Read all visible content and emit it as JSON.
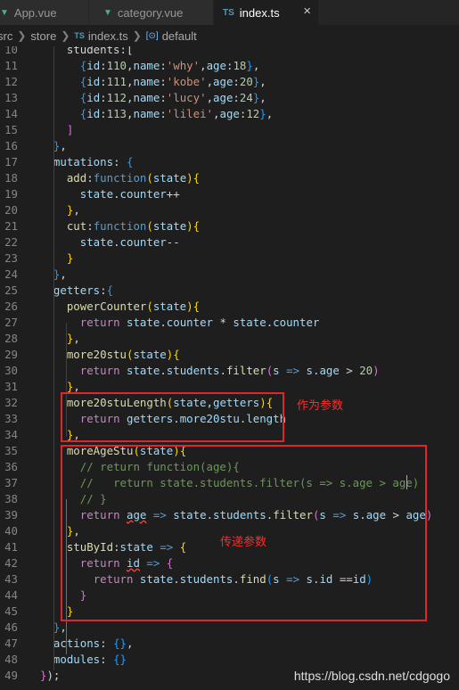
{
  "tabs": [
    {
      "label": "App.vue",
      "icon": "vue-icon"
    },
    {
      "label": "category.vue",
      "icon": "vue-icon"
    },
    {
      "label": "index.ts",
      "icon": "ts-icon",
      "active": true
    }
  ],
  "breadcrumb": {
    "folder1": "src",
    "folder2": "store",
    "file": "index.ts",
    "symbol": "default",
    "ts_badge": "TS"
  },
  "editor": {
    "lines": [
      {
        "n": "10",
        "t": [
          [
            "v",
            "    students:["
          ]
        ]
      },
      {
        "n": "11",
        "t": [
          [
            "v",
            "      "
          ],
          [
            "b3",
            "{"
          ],
          [
            "p",
            "id"
          ],
          [
            "v",
            ":"
          ],
          [
            "n",
            "110"
          ],
          [
            "v",
            ","
          ],
          [
            "p",
            "name"
          ],
          [
            "v",
            ":"
          ],
          [
            "s",
            "'why'"
          ],
          [
            "v",
            ","
          ],
          [
            "p",
            "age"
          ],
          [
            "v",
            ":"
          ],
          [
            "n",
            "18"
          ],
          [
            "b3",
            "}"
          ],
          [
            "v",
            ","
          ]
        ]
      },
      {
        "n": "12",
        "t": [
          [
            "v",
            "      "
          ],
          [
            "b3",
            "{"
          ],
          [
            "p",
            "id"
          ],
          [
            "v",
            ":"
          ],
          [
            "n",
            "111"
          ],
          [
            "v",
            ","
          ],
          [
            "p",
            "name"
          ],
          [
            "v",
            ":"
          ],
          [
            "s",
            "'kobe'"
          ],
          [
            "v",
            ","
          ],
          [
            "p",
            "age"
          ],
          [
            "v",
            ":"
          ],
          [
            "n",
            "20"
          ],
          [
            "b3",
            "}"
          ],
          [
            "v",
            ","
          ]
        ]
      },
      {
        "n": "13",
        "t": [
          [
            "v",
            "      "
          ],
          [
            "b3",
            "{"
          ],
          [
            "p",
            "id"
          ],
          [
            "v",
            ":"
          ],
          [
            "n",
            "112"
          ],
          [
            "v",
            ","
          ],
          [
            "p",
            "name"
          ],
          [
            "v",
            ":"
          ],
          [
            "s",
            "'lucy'"
          ],
          [
            "v",
            ","
          ],
          [
            "p",
            "age"
          ],
          [
            "v",
            ":"
          ],
          [
            "n",
            "24"
          ],
          [
            "b3",
            "}"
          ],
          [
            "v",
            ","
          ]
        ]
      },
      {
        "n": "14",
        "t": [
          [
            "v",
            "      "
          ],
          [
            "b3",
            "{"
          ],
          [
            "p",
            "id"
          ],
          [
            "v",
            ":"
          ],
          [
            "n",
            "113"
          ],
          [
            "v",
            ","
          ],
          [
            "p",
            "name"
          ],
          [
            "v",
            ":"
          ],
          [
            "s",
            "'lilei'"
          ],
          [
            "v",
            ","
          ],
          [
            "p",
            "age"
          ],
          [
            "v",
            ":"
          ],
          [
            "n",
            "12"
          ],
          [
            "b3",
            "}"
          ],
          [
            "v",
            ","
          ]
        ]
      },
      {
        "n": "15",
        "t": [
          [
            "v",
            "    "
          ],
          [
            "b2",
            "]"
          ]
        ]
      },
      {
        "n": "16",
        "t": [
          [
            "v",
            "  "
          ],
          [
            "b3",
            "}"
          ],
          [
            "v",
            ","
          ]
        ]
      },
      {
        "n": "17",
        "t": [
          [
            "v",
            "  "
          ],
          [
            "p",
            "mutations"
          ],
          [
            "v",
            ": "
          ],
          [
            "b3",
            "{"
          ]
        ]
      },
      {
        "n": "18",
        "t": [
          [
            "v",
            "    "
          ],
          [
            "f",
            "add"
          ],
          [
            "v",
            ":"
          ],
          [
            "k",
            "function"
          ],
          [
            "b1",
            "("
          ],
          [
            "p",
            "state"
          ],
          [
            "b1",
            ")"
          ],
          [
            "b1",
            "{"
          ]
        ]
      },
      {
        "n": "19",
        "t": [
          [
            "v",
            "      "
          ],
          [
            "p",
            "state"
          ],
          [
            "v",
            "."
          ],
          [
            "p",
            "counter"
          ],
          [
            "v",
            "++"
          ]
        ]
      },
      {
        "n": "20",
        "t": [
          [
            "v",
            "    "
          ],
          [
            "b1",
            "}"
          ],
          [
            "v",
            ","
          ]
        ]
      },
      {
        "n": "21",
        "t": [
          [
            "v",
            "    "
          ],
          [
            "f",
            "cut"
          ],
          [
            "v",
            ":"
          ],
          [
            "k",
            "function"
          ],
          [
            "b1",
            "("
          ],
          [
            "p",
            "state"
          ],
          [
            "b1",
            ")"
          ],
          [
            "b1",
            "{"
          ]
        ]
      },
      {
        "n": "22",
        "t": [
          [
            "v",
            "      "
          ],
          [
            "p",
            "state"
          ],
          [
            "v",
            "."
          ],
          [
            "p",
            "counter"
          ],
          [
            "v",
            "--"
          ]
        ]
      },
      {
        "n": "23",
        "t": [
          [
            "v",
            "    "
          ],
          [
            "b1",
            "}"
          ]
        ]
      },
      {
        "n": "24",
        "t": [
          [
            "v",
            "  "
          ],
          [
            "b3",
            "}"
          ],
          [
            "v",
            ","
          ]
        ]
      },
      {
        "n": "25",
        "t": [
          [
            "v",
            "  "
          ],
          [
            "p",
            "getters"
          ],
          [
            "v",
            ":"
          ],
          [
            "b3",
            "{"
          ]
        ]
      },
      {
        "n": "26",
        "t": [
          [
            "v",
            "    "
          ],
          [
            "f",
            "powerCounter"
          ],
          [
            "b1",
            "("
          ],
          [
            "p",
            "state"
          ],
          [
            "b1",
            ")"
          ],
          [
            "b1",
            "{"
          ]
        ]
      },
      {
        "n": "27",
        "t": [
          [
            "v",
            "      "
          ],
          [
            "ctl",
            "return"
          ],
          [
            "v",
            " "
          ],
          [
            "p",
            "state"
          ],
          [
            "v",
            "."
          ],
          [
            "p",
            "counter"
          ],
          [
            "v",
            " * "
          ],
          [
            "p",
            "state"
          ],
          [
            "v",
            "."
          ],
          [
            "p",
            "counter"
          ]
        ]
      },
      {
        "n": "28",
        "t": [
          [
            "v",
            "    "
          ],
          [
            "b1",
            "}"
          ],
          [
            "v",
            ","
          ]
        ]
      },
      {
        "n": "29",
        "t": [
          [
            "v",
            "    "
          ],
          [
            "f",
            "more20stu"
          ],
          [
            "b1",
            "("
          ],
          [
            "p",
            "state"
          ],
          [
            "b1",
            ")"
          ],
          [
            "b1",
            "{"
          ]
        ]
      },
      {
        "n": "30",
        "t": [
          [
            "v",
            "      "
          ],
          [
            "ctl",
            "return"
          ],
          [
            "v",
            " "
          ],
          [
            "p",
            "state"
          ],
          [
            "v",
            "."
          ],
          [
            "p",
            "students"
          ],
          [
            "v",
            "."
          ],
          [
            "f",
            "filter"
          ],
          [
            "b2",
            "("
          ],
          [
            "p",
            "s"
          ],
          [
            "v",
            " "
          ],
          [
            "k",
            "=>"
          ],
          [
            "v",
            " "
          ],
          [
            "p",
            "s"
          ],
          [
            "v",
            "."
          ],
          [
            "p",
            "age"
          ],
          [
            "v",
            " > "
          ],
          [
            "n",
            "20"
          ],
          [
            "b2",
            ")"
          ]
        ]
      },
      {
        "n": "31",
        "t": [
          [
            "v",
            "    "
          ],
          [
            "b1",
            "}"
          ],
          [
            "v",
            ","
          ]
        ]
      },
      {
        "n": "32",
        "t": [
          [
            "v",
            "    "
          ],
          [
            "f",
            "more20stuLength"
          ],
          [
            "b1",
            "("
          ],
          [
            "p",
            "state"
          ],
          [
            "v",
            ","
          ],
          [
            "p",
            "getters"
          ],
          [
            "b1",
            ")"
          ],
          [
            "b1",
            "{"
          ]
        ]
      },
      {
        "n": "33",
        "t": [
          [
            "v",
            "      "
          ],
          [
            "ctl",
            "return"
          ],
          [
            "v",
            " "
          ],
          [
            "p",
            "getters"
          ],
          [
            "v",
            "."
          ],
          [
            "p",
            "more20stu"
          ],
          [
            "v",
            "."
          ],
          [
            "p",
            "length"
          ]
        ]
      },
      {
        "n": "34",
        "t": [
          [
            "v",
            "    "
          ],
          [
            "b1",
            "}"
          ],
          [
            "v",
            ","
          ]
        ]
      },
      {
        "n": "35",
        "t": [
          [
            "v",
            "    "
          ],
          [
            "f",
            "moreAgeStu"
          ],
          [
            "b1",
            "("
          ],
          [
            "p",
            "state"
          ],
          [
            "b1",
            ")"
          ],
          [
            "b1",
            "{"
          ]
        ]
      },
      {
        "n": "36",
        "t": [
          [
            "v",
            "      "
          ],
          [
            "c",
            "// return function(age){"
          ]
        ]
      },
      {
        "n": "37",
        "t": [
          [
            "v",
            "      "
          ],
          [
            "c",
            "//   return state.students.filter(s => s.age > age)"
          ]
        ]
      },
      {
        "n": "38",
        "t": [
          [
            "v",
            "      "
          ],
          [
            "c",
            "// }"
          ]
        ]
      },
      {
        "n": "39",
        "t": [
          [
            "v",
            "      "
          ],
          [
            "ctl",
            "return"
          ],
          [
            "v",
            " "
          ],
          [
            "p",
            "age"
          ],
          [
            "v",
            " "
          ],
          [
            "k",
            "=>"
          ],
          [
            "v",
            " "
          ],
          [
            "p",
            "state"
          ],
          [
            "v",
            "."
          ],
          [
            "p",
            "students"
          ],
          [
            "v",
            "."
          ],
          [
            "f",
            "filter"
          ],
          [
            "b2",
            "("
          ],
          [
            "p",
            "s"
          ],
          [
            "v",
            " "
          ],
          [
            "k",
            "=>"
          ],
          [
            "v",
            " "
          ],
          [
            "p",
            "s"
          ],
          [
            "v",
            "."
          ],
          [
            "p",
            "age"
          ],
          [
            "v",
            " > "
          ],
          [
            "p",
            "age"
          ],
          [
            "b2",
            ")"
          ]
        ]
      },
      {
        "n": "40",
        "t": [
          [
            "v",
            "    "
          ],
          [
            "b1",
            "}"
          ],
          [
            "v",
            ","
          ]
        ]
      },
      {
        "n": "41",
        "t": [
          [
            "v",
            "    "
          ],
          [
            "f",
            "stuById"
          ],
          [
            "v",
            ":"
          ],
          [
            "p",
            "state"
          ],
          [
            "v",
            " "
          ],
          [
            "k",
            "=>"
          ],
          [
            "v",
            " "
          ],
          [
            "b1",
            "{"
          ]
        ]
      },
      {
        "n": "42",
        "t": [
          [
            "v",
            "      "
          ],
          [
            "ctl",
            "return"
          ],
          [
            "v",
            " "
          ],
          [
            "p",
            "id"
          ],
          [
            "v",
            " "
          ],
          [
            "k",
            "=>"
          ],
          [
            "v",
            " "
          ],
          [
            "b2",
            "{"
          ]
        ]
      },
      {
        "n": "43",
        "t": [
          [
            "v",
            "        "
          ],
          [
            "ctl",
            "return"
          ],
          [
            "v",
            " "
          ],
          [
            "p",
            "state"
          ],
          [
            "v",
            "."
          ],
          [
            "p",
            "students"
          ],
          [
            "v",
            "."
          ],
          [
            "f",
            "find"
          ],
          [
            "b3",
            "("
          ],
          [
            "p",
            "s"
          ],
          [
            "v",
            " "
          ],
          [
            "k",
            "=>"
          ],
          [
            "v",
            " "
          ],
          [
            "p",
            "s"
          ],
          [
            "v",
            "."
          ],
          [
            "p",
            "id"
          ],
          [
            "v",
            " =="
          ],
          [
            "p",
            "id"
          ],
          [
            "b3",
            ")"
          ]
        ]
      },
      {
        "n": "44",
        "t": [
          [
            "v",
            "      "
          ],
          [
            "b2",
            "}"
          ]
        ]
      },
      {
        "n": "45",
        "t": [
          [
            "v",
            "    "
          ],
          [
            "b1",
            "}"
          ]
        ]
      },
      {
        "n": "46",
        "t": [
          [
            "v",
            "  "
          ],
          [
            "b3",
            "}"
          ],
          [
            "v",
            ","
          ]
        ]
      },
      {
        "n": "47",
        "t": [
          [
            "v",
            "  "
          ],
          [
            "p",
            "actions"
          ],
          [
            "v",
            ": "
          ],
          [
            "b3",
            "{}"
          ],
          [
            "v",
            ","
          ]
        ]
      },
      {
        "n": "48",
        "t": [
          [
            "v",
            "  "
          ],
          [
            "p",
            "modules"
          ],
          [
            "v",
            ": "
          ],
          [
            "b3",
            "{}"
          ]
        ]
      },
      {
        "n": "49",
        "t": [
          [
            "b2",
            "}"
          ],
          [
            "v",
            ");"
          ]
        ]
      }
    ]
  },
  "annotations": {
    "pass_as_param": "作为参数",
    "return_param": "传递参数"
  },
  "watermark": "https://blog.csdn.net/cdgogo",
  "colors": {
    "annotation_red": "#e0262b",
    "editor_bg": "#1e1e1e",
    "tab_bg": "#2d2d2d"
  }
}
